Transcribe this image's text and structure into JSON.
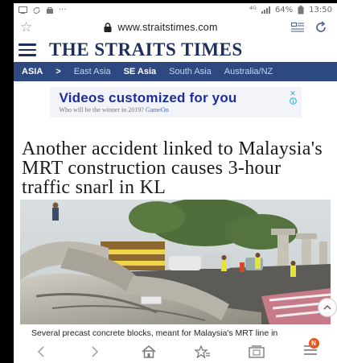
{
  "status_bar": {
    "signal_text": "⁴ᴳ",
    "battery": "64%",
    "time": "13:50",
    "more": "···"
  },
  "browser": {
    "url": "www.straitstimes.com"
  },
  "masthead": {
    "logo_text": "THE STRAITS TIMES"
  },
  "section_nav": {
    "items": [
      {
        "label": "ASIA"
      },
      {
        "label": ">"
      },
      {
        "label": "East Asia"
      },
      {
        "label": "SE Asia"
      },
      {
        "label": "South Asia"
      },
      {
        "label": "Australia/NZ"
      }
    ]
  },
  "ad": {
    "headline": "Videos customized for you",
    "sub_text": "Who will be the winner in 2019?",
    "sub_brand": "GameOn"
  },
  "article": {
    "headline": "Another accident linked to Malaysia's MRT construction causes 3-hour traffic snarl in KL",
    "caption": "Several precast concrete blocks, meant for Malaysia's MRT line in"
  },
  "bottom_nav": {
    "menu_badge": "N"
  },
  "colors": {
    "brand_navy": "#1e2f5e",
    "nav_bar": "#2e4982",
    "ad_blue": "#1c2e9a",
    "badge_orange": "#e9551f"
  }
}
